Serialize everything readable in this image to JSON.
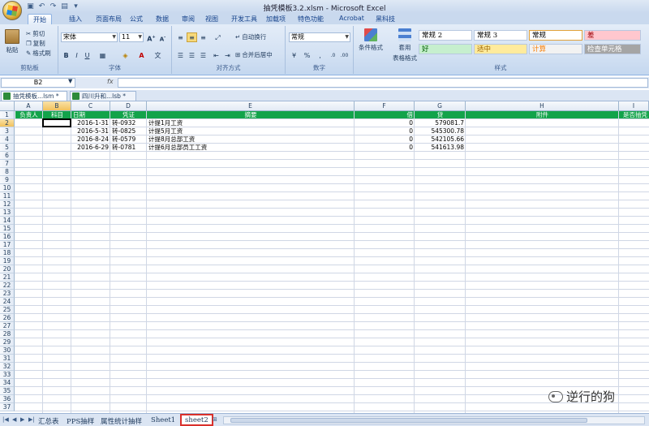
{
  "window": {
    "title": "抽凭模板3.2.xlsm - Microsoft Excel"
  },
  "ribbon_tabs": [
    "开始",
    "插入",
    "页面布局",
    "公式",
    "数据",
    "审阅",
    "视图",
    "开发工具",
    "加载项",
    "特色功能",
    "Acrobat",
    "黑科技"
  ],
  "clipboard": {
    "paste": "粘贴",
    "cut": "剪切",
    "copy": "复制",
    "format_painter": "格式刷",
    "label": "剪贴板"
  },
  "font": {
    "name": "宋体",
    "size": "11",
    "label": "字体"
  },
  "alignment": {
    "wrap": "自动换行",
    "merge": "合并后居中",
    "label": "对齐方式"
  },
  "number": {
    "format": "常规",
    "label": "数字"
  },
  "styles": {
    "conditional": "条件格式",
    "table_format": "套用",
    "table_format2": "表格格式",
    "cells": [
      {
        "text": "常规 2",
        "bg": "#ffffff",
        "fg": "#000000"
      },
      {
        "text": "常规 3",
        "bg": "#ffffff",
        "fg": "#000000"
      },
      {
        "text": "常规",
        "bg": "#ffffff",
        "fg": "#000000"
      },
      {
        "text": "差",
        "bg": "#ffc7ce",
        "fg": "#9c0006"
      },
      {
        "text": "好",
        "bg": "#c6efce",
        "fg": "#006100"
      },
      {
        "text": "适中",
        "bg": "#ffeb9c",
        "fg": "#9c6500"
      },
      {
        "text": "计算",
        "bg": "#f2f2f2",
        "fg": "#fa7d00"
      },
      {
        "text": "检查单元格",
        "bg": "#a5a5a5",
        "fg": "#ffffff"
      }
    ],
    "label": "样式"
  },
  "formula_bar": {
    "name_box": "B2",
    "fx": "fx",
    "value": ""
  },
  "workbooks": [
    {
      "name": "抽凭模板...lsm *",
      "active": true
    },
    {
      "name": "四川升和...lsb *",
      "active": false
    }
  ],
  "columns": [
    "A",
    "B",
    "C",
    "D",
    "E",
    "F",
    "G",
    "H",
    "I"
  ],
  "header_row": [
    "负责人",
    "科目",
    "日期",
    "凭证",
    "摘要",
    "借",
    "贷",
    "附件",
    "是否抽凭"
  ],
  "rows": [
    {
      "date": "2016-1-31",
      "voucher": "转-0932",
      "summary": "计提1月工资",
      "debit": "0",
      "credit": "579081.7"
    },
    {
      "date": "2016-5-31",
      "voucher": "转-0825",
      "summary": "计提5月工资",
      "debit": "0",
      "credit": "545300.78"
    },
    {
      "date": "2016-8-24",
      "voucher": "转-0579",
      "summary": "计提8月总部工资",
      "debit": "0",
      "credit": "542105.66"
    },
    {
      "date": "2016-6-29",
      "voucher": "转-0781",
      "summary": "计提6月总部员工工资",
      "debit": "0",
      "credit": "541613.98"
    }
  ],
  "row_numbers": [
    "1",
    "2",
    "3",
    "4",
    "5",
    "6",
    "7",
    "8",
    "9",
    "10",
    "11",
    "12",
    "13",
    "14",
    "15",
    "16",
    "17",
    "18",
    "19",
    "20",
    "21",
    "22",
    "23",
    "24",
    "25",
    "26",
    "27",
    "28",
    "29",
    "30",
    "31",
    "32",
    "33",
    "34",
    "35",
    "36",
    "37"
  ],
  "active_cell": "B2",
  "sheets": [
    "汇总表",
    "PPS抽样",
    "属性统计抽样",
    "Sheet1",
    "sheet2"
  ],
  "active_sheet": "sheet2",
  "watermark": "逆行的狗",
  "colors": {
    "header_band": "#12a34a",
    "highlight": "#d9302b"
  }
}
